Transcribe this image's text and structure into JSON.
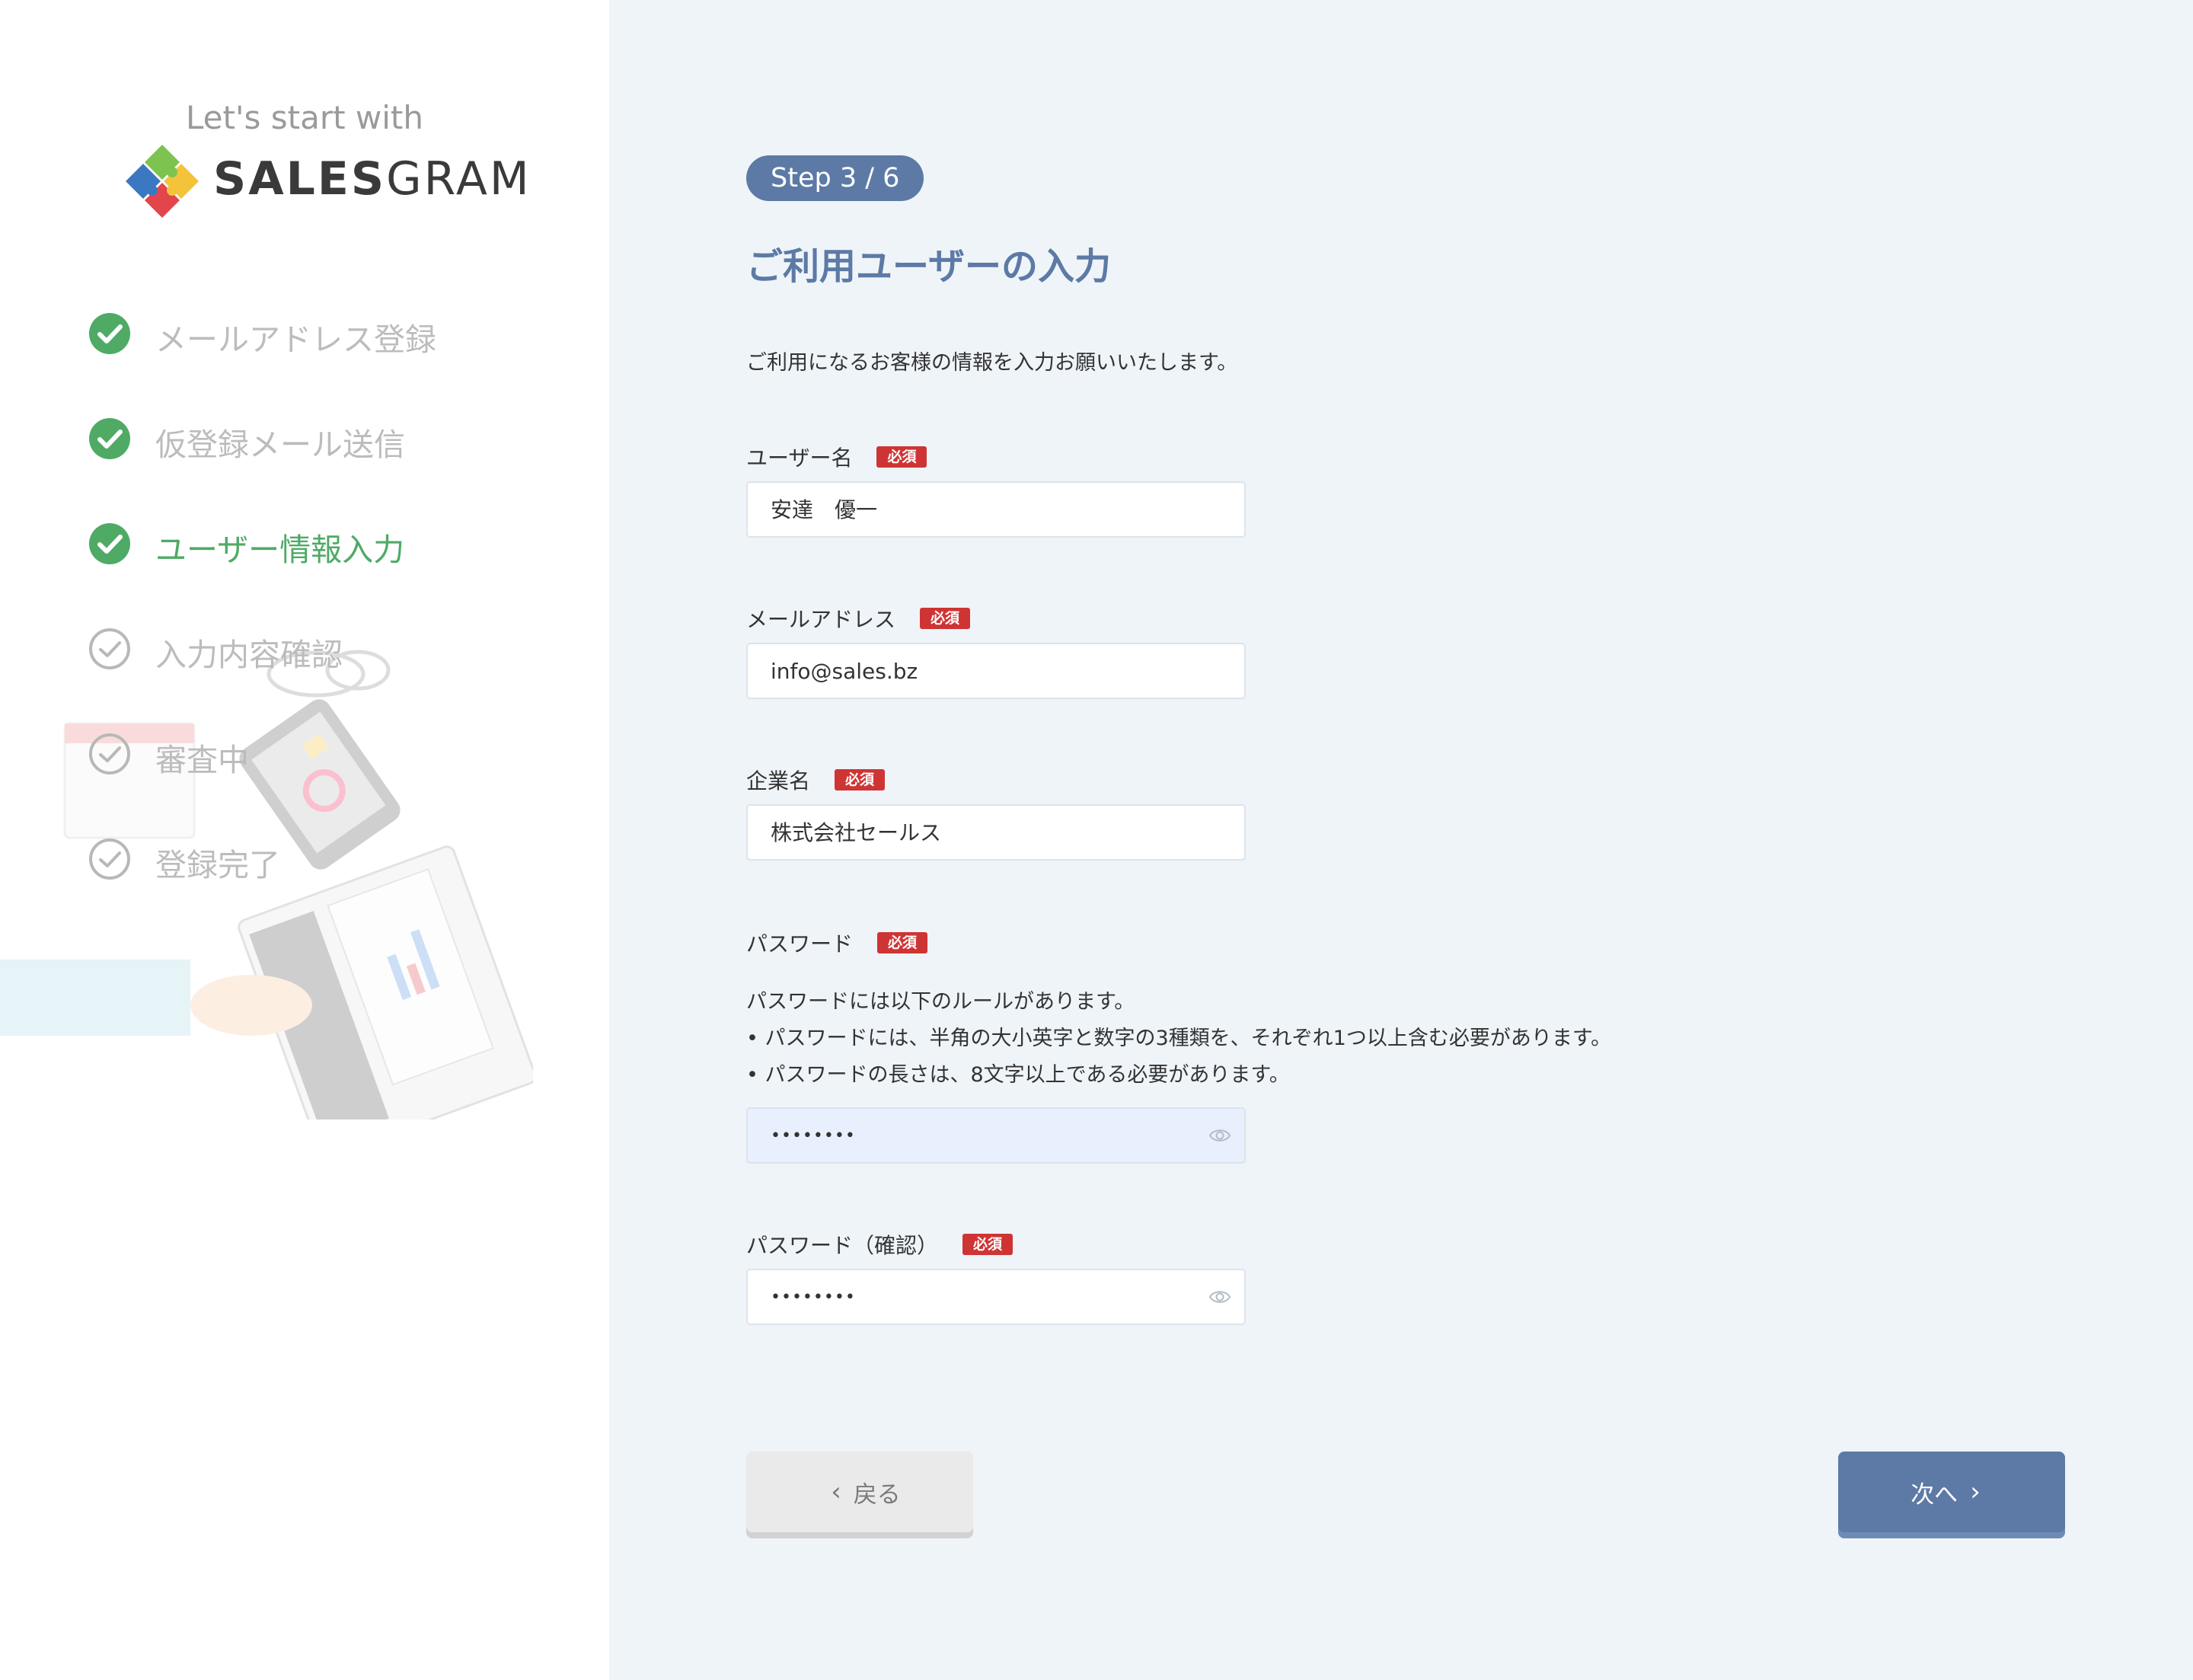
{
  "brand": {
    "tagline": "Let's start with",
    "logo_bold": "SALES",
    "logo_light": "GRAM",
    "colors": {
      "green": "#4faa66",
      "accent": "#5d7aa6",
      "required": "#cf3434",
      "panel_bg": "#eff4f9"
    }
  },
  "sidebar": {
    "steps": [
      {
        "label": "メールアドレス登録",
        "state": "done",
        "icon": "check-circle-filled-icon"
      },
      {
        "label": "仮登録メール送信",
        "state": "done",
        "icon": "check-circle-filled-icon"
      },
      {
        "label": "ユーザー情報入力",
        "state": "current",
        "icon": "check-circle-filled-icon"
      },
      {
        "label": "入力内容確認",
        "state": "pending",
        "icon": "check-circle-outline-icon"
      },
      {
        "label": "審査中",
        "state": "pending",
        "icon": "check-circle-outline-icon"
      },
      {
        "label": "登録完了",
        "state": "pending",
        "icon": "check-circle-outline-icon"
      }
    ]
  },
  "main": {
    "step_badge": "Step 3 / 6",
    "title": "ご利用ユーザーの入力",
    "description": "ご利用になるお客様の情報を入力お願いいたします。",
    "required_badge": "必須",
    "fields": {
      "username": {
        "label": "ユーザー名",
        "value": "安達　優一"
      },
      "email": {
        "label": "メールアドレス",
        "value": "info@sales.bz"
      },
      "company": {
        "label": "企業名",
        "value": "株式会社セールス"
      },
      "password": {
        "label": "パスワード",
        "value": "••••••••"
      },
      "password_confirm": {
        "label": "パスワード（確認）",
        "value": "••••••••"
      }
    },
    "password_rules": {
      "intro": "パスワードには以下のルールがあります。",
      "rule1": "• パスワードには、半角の大小英字と数字の3種類を、それぞれ1つ以上含む必要があります。",
      "rule2": "• パスワードの長さは、8文字以上である必要があります。"
    }
  },
  "footer": {
    "back_label": "戻る",
    "next_label": "次へ",
    "back_icon": "chevron-left-icon",
    "next_icon": "chevron-right-icon"
  }
}
